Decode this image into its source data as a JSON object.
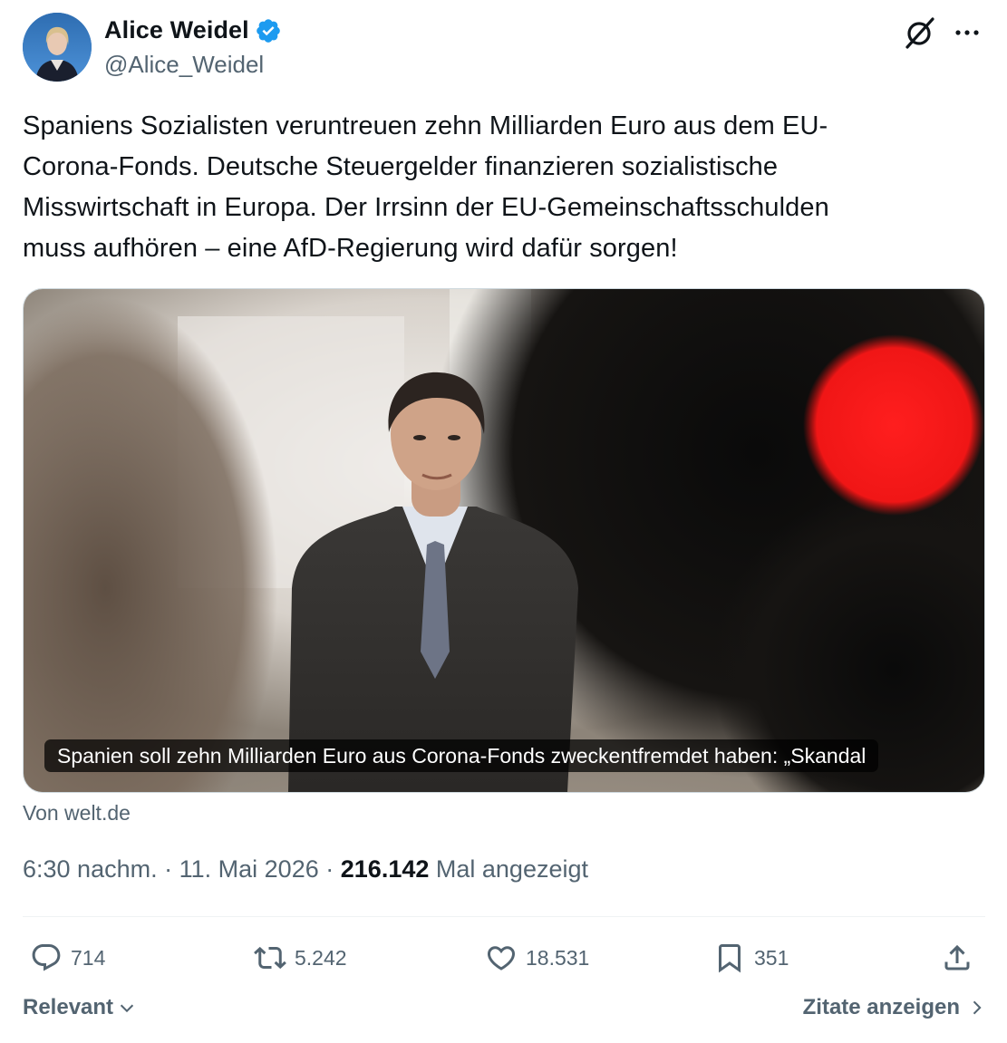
{
  "author": {
    "display_name": "Alice Weidel",
    "handle": "@Alice_Weidel",
    "verified": true,
    "verified_color": "#1d9bf0"
  },
  "header_actions": {
    "grok_icon": "grok-icon",
    "more_icon": "more-icon"
  },
  "tweet": {
    "text": "Spaniens Sozialisten veruntreuen zehn Milliarden Euro aus dem EU-\nCorona-Fonds. Deutsche Steuergelder finanzieren sozialistische\nMisswirtschaft in Europa. Der Irrsinn der EU-Gemeinschaftsschulden\nmuss aufhören – eine AfD-Regierung wird dafür sorgen!"
  },
  "link_card": {
    "caption": "Spanien soll zehn Milliarden Euro aus Corona-Fonds zweckentfremdet haben: „Skandal",
    "source": "Von welt.de"
  },
  "meta": {
    "time": "6:30 nachm.",
    "separator": "·",
    "date": "11. Mai 2026",
    "views_count": "216.142",
    "views_label": "Mal angezeigt"
  },
  "actions": {
    "replies": "714",
    "reposts": "5.242",
    "likes": "18.531",
    "bookmarks": "351"
  },
  "footer": {
    "sort_label": "Relevant",
    "quotes_label": "Zitate anzeigen"
  },
  "colors": {
    "text_primary": "#0f1419",
    "text_secondary": "#536471",
    "border": "#cfd9de"
  }
}
